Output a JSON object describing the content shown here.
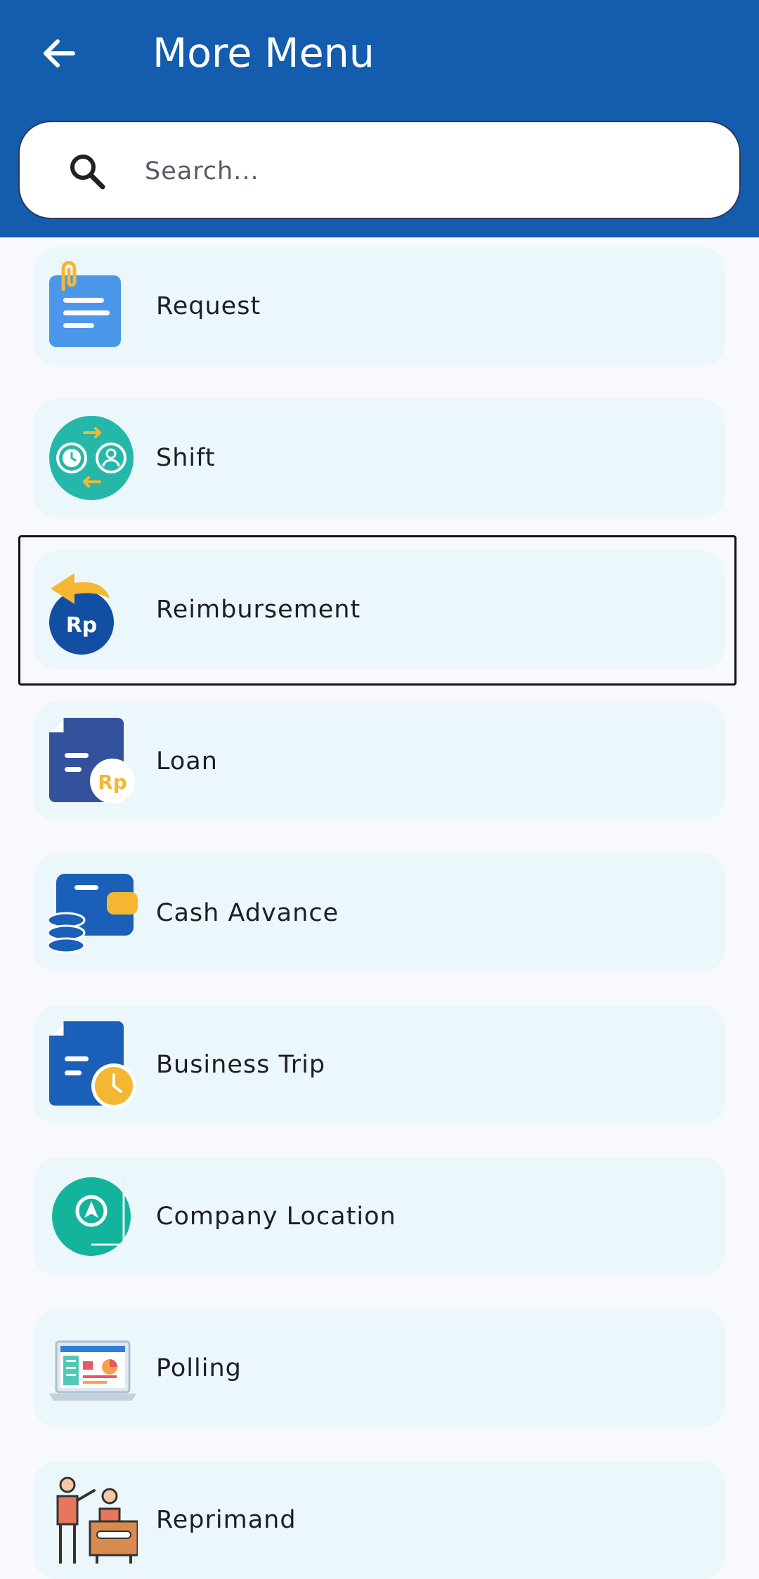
{
  "header": {
    "title": "More Menu",
    "back_icon": "arrow-left-icon",
    "background_color": "#135cae"
  },
  "search": {
    "placeholder": "Search...",
    "value": "",
    "icon": "search-icon"
  },
  "menu": {
    "items": [
      {
        "label": "Request",
        "icon": "request-document-icon"
      },
      {
        "label": "Shift",
        "icon": "shift-swap-icon"
      },
      {
        "label": "Reimbursement",
        "icon": "reimbursement-rp-icon"
      },
      {
        "label": "Loan",
        "icon": "loan-document-rp-icon"
      },
      {
        "label": "Cash Advance",
        "icon": "wallet-coins-icon"
      },
      {
        "label": "Business Trip",
        "icon": "document-clock-icon"
      },
      {
        "label": "Company Location",
        "icon": "location-compass-icon"
      },
      {
        "label": "Polling",
        "icon": "laptop-chart-icon"
      },
      {
        "label": "Reprimand",
        "icon": "reprimand-people-icon"
      }
    ],
    "highlighted_item": "Reimbursement",
    "item_background": "#ebf7fa"
  }
}
